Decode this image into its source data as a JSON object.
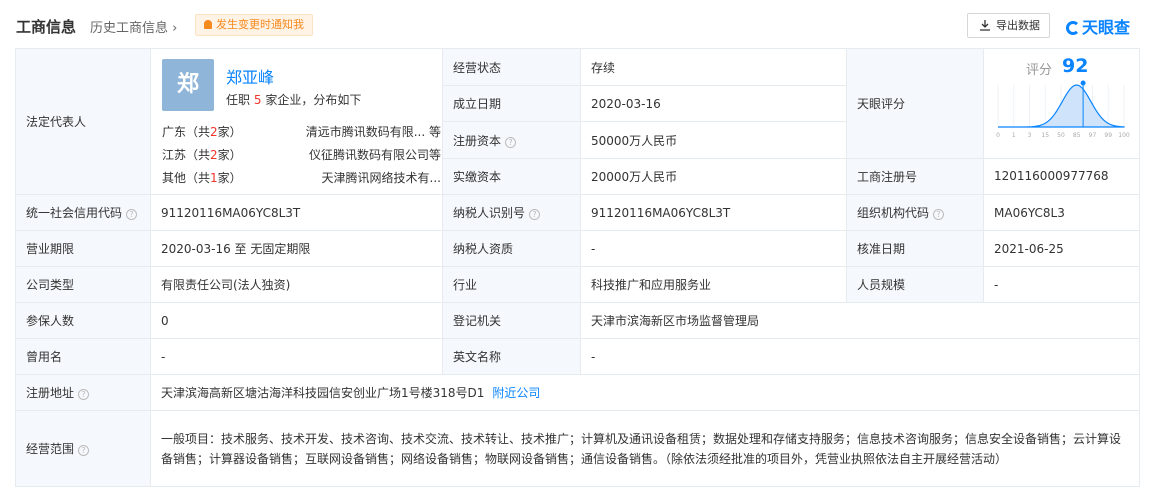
{
  "header": {
    "title": "工商信息",
    "history_link": "历史工商信息",
    "notify_button": "发生变更时通知我",
    "export_button": "导出数据",
    "brand": "天眼查"
  },
  "legal_rep": {
    "label": "法定代表人",
    "avatar_char": "郑",
    "name": "郑亚峰",
    "info_prefix": "任职",
    "info_count": "5",
    "info_suffix": "家企业，分布如下",
    "regions": [
      {
        "region_prefix": "广东（共",
        "count": "2",
        "region_suffix": "家）",
        "company": "清远市腾讯数码有限...  等"
      },
      {
        "region_prefix": "江苏（共",
        "count": "2",
        "region_suffix": "家）",
        "company": "仪征腾讯数码有限公司等"
      },
      {
        "region_prefix": "其他（共",
        "count": "1",
        "region_suffix": "家）",
        "company": "天津腾讯网络技术有..."
      }
    ]
  },
  "fields": {
    "status_label": "经营状态",
    "status_value": "存续",
    "founded_label": "成立日期",
    "founded_value": "2020-03-16",
    "reg_capital_label": "注册资本",
    "reg_capital_value": "50000万人民币",
    "paid_capital_label": "实缴资本",
    "paid_capital_value": "20000万人民币",
    "tianyan_label": "天眼评分",
    "reg_no_label": "工商注册号",
    "reg_no_value": "120116000977768",
    "credit_code_label": "统一社会信用代码",
    "credit_code_value": "91120116MA06YC8L3T",
    "tax_id_label": "纳税人识别号",
    "tax_id_value": "91120116MA06YC8L3T",
    "org_code_label": "组织机构代码",
    "org_code_value": "MA06YC8L3",
    "term_label": "营业期限",
    "term_value": "2020-03-16  至  无固定期限",
    "tax_qual_label": "纳税人资质",
    "tax_qual_value": "-",
    "approve_label": "核准日期",
    "approve_value": "2021-06-25",
    "type_label": "公司类型",
    "type_value": "有限责任公司(法人独资)",
    "industry_label": "行业",
    "industry_value": "科技推广和应用服务业",
    "staff_label": "人员规模",
    "staff_value": "-",
    "insured_label": "参保人数",
    "insured_value": "0",
    "authority_label": "登记机关",
    "authority_value": "天津市滨海新区市场监督管理局",
    "former_label": "曾用名",
    "former_value": "-",
    "en_name_label": "英文名称",
    "en_name_value": "-",
    "address_label": "注册地址",
    "address_value": "天津滨海高新区塘沽海洋科技园信安创业广场1号楼318号D1",
    "nearby_link": "附近公司",
    "scope_label": "经营范围",
    "scope_value": "一般项目：技术服务、技术开发、技术咨询、技术交流、技术转让、技术推广；计算机及通讯设备租赁；数据处理和存储支持服务；信息技术咨询服务；信息安全设备销售；云计算设备销售；计算器设备销售；互联网设备销售；网络设备销售；物联网设备销售；通信设备销售。（除依法须经批准的项目外，凭营业执照依法自主开展经营活动）"
  },
  "score": {
    "label": "评分",
    "value": 92,
    "scale": [
      "0",
      "1",
      "3",
      "15",
      "50",
      "85",
      "97",
      "99",
      "100"
    ]
  },
  "colors": {
    "accent": "#0a84ff",
    "highlight": "#f0342c",
    "label_bg": "#f5f8fc"
  }
}
